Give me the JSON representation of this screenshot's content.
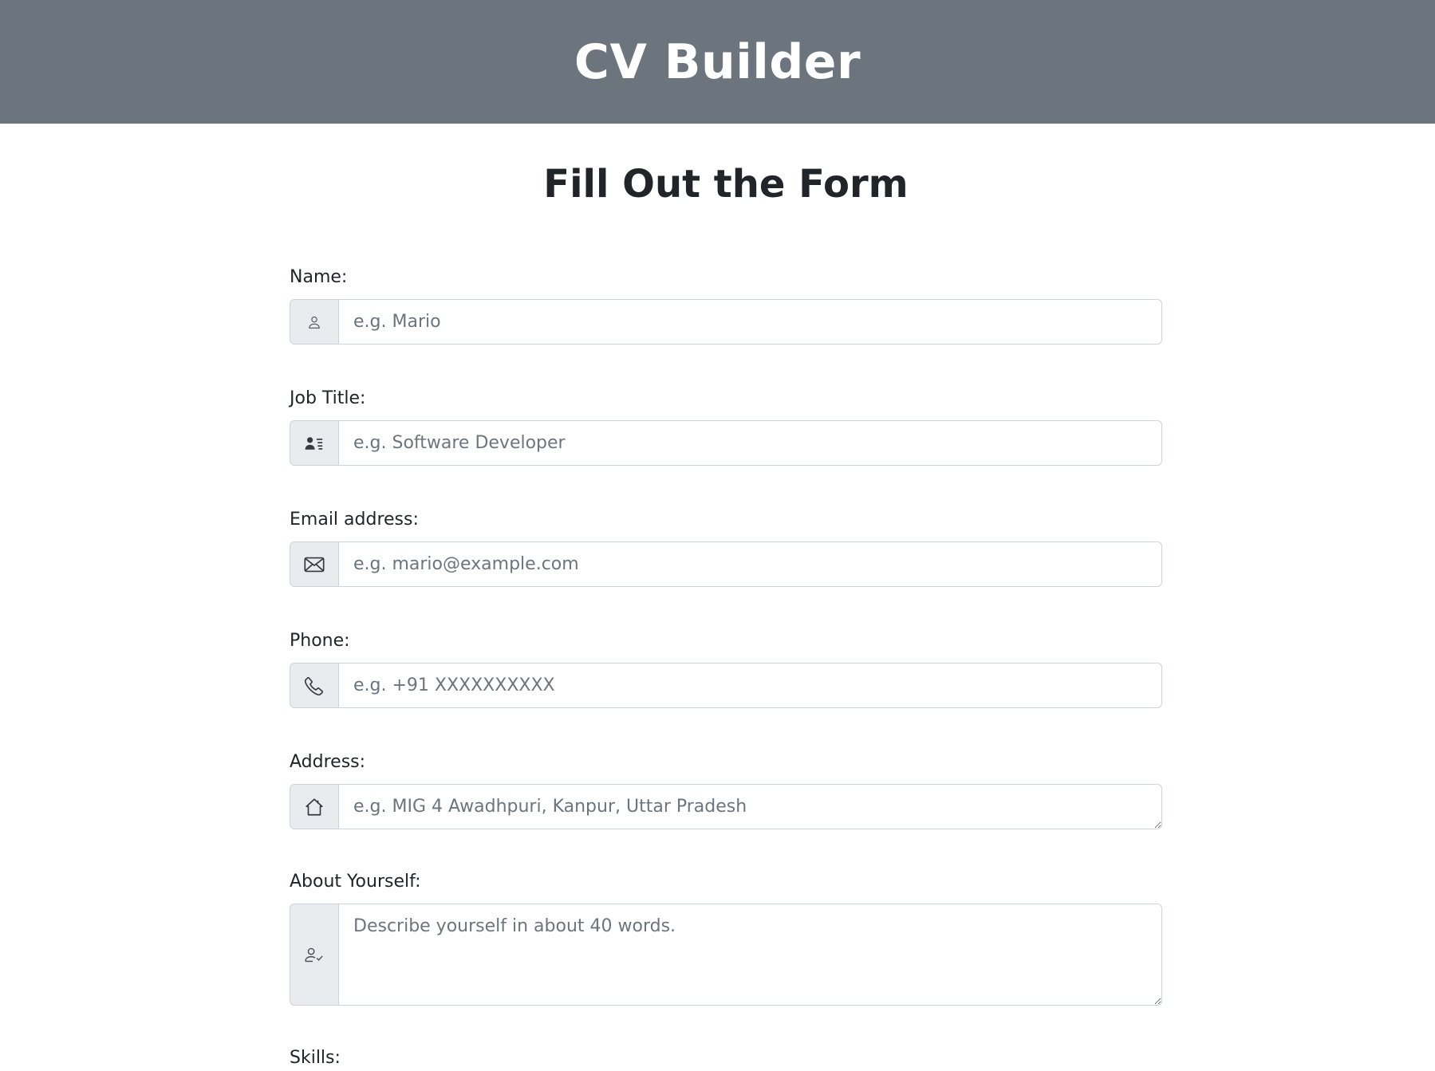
{
  "header": {
    "title": "CV Builder"
  },
  "page": {
    "heading": "Fill Out the Form"
  },
  "form": {
    "name": {
      "label": "Name:",
      "placeholder": "e.g. Mario",
      "icon": "person-icon"
    },
    "job_title": {
      "label": "Job Title:",
      "placeholder": "e.g. Software Developer",
      "icon": "person-lines-icon"
    },
    "email": {
      "label": "Email address:",
      "placeholder": "e.g. mario@example.com",
      "icon": "envelope-icon"
    },
    "phone": {
      "label": "Phone:",
      "placeholder": "e.g. +91 XXXXXXXXXX",
      "icon": "telephone-icon"
    },
    "address": {
      "label": "Address:",
      "placeholder": "e.g. MIG 4 Awadhpuri, Kanpur, Uttar Pradesh",
      "icon": "house-icon"
    },
    "about": {
      "label": "About Yourself:",
      "placeholder": "Describe yourself in about 40 words.",
      "icon": "person-check-icon"
    },
    "skills": {
      "label": "Skills:"
    }
  },
  "colors": {
    "header_bg": "#6c757d",
    "addon_bg": "#e9ecef",
    "border": "#ced4da",
    "placeholder": "#6c757d",
    "text": "#212529"
  }
}
